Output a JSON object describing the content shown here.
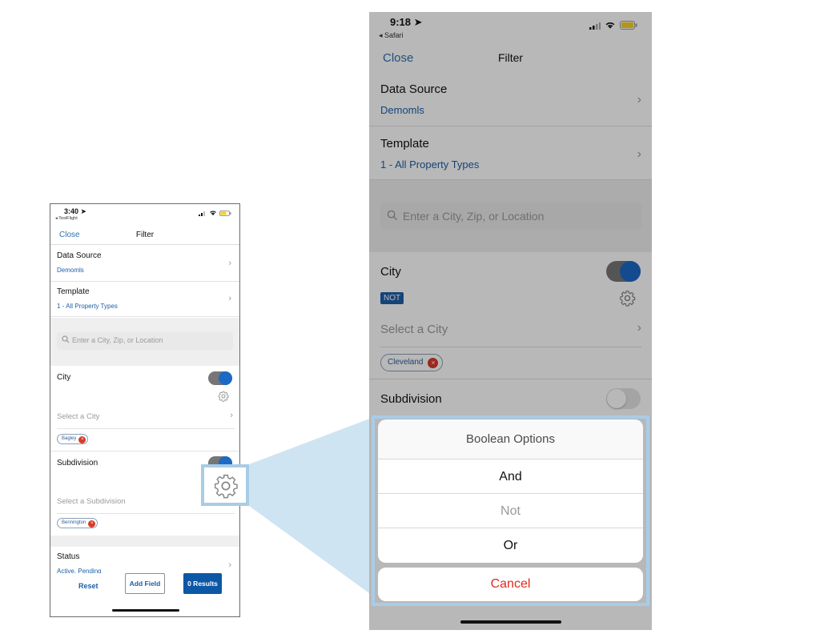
{
  "small_phone": {
    "status": {
      "time": "3:40",
      "back_app": "TestFlight"
    },
    "nav": {
      "close": "Close",
      "title": "Filter"
    },
    "data_source": {
      "label": "Data Source",
      "value": "Demomls"
    },
    "template": {
      "label": "Template",
      "value": "1 - All Property Types"
    },
    "search": {
      "placeholder": "Enter a City, Zip, or Location"
    },
    "city": {
      "label": "City",
      "select_label": "Select a City",
      "chip": "Bagley",
      "toggle_on": true
    },
    "subdivision": {
      "label": "Subdivision",
      "select_label": "Select a Subdivision",
      "chip": "Bennington",
      "toggle_on": true
    },
    "status_field": {
      "label": "Status",
      "value": "Active, Pending"
    },
    "bottom": {
      "reset": "Reset",
      "add_field": "Add Field",
      "results": "0 Results"
    }
  },
  "large_phone": {
    "status": {
      "time": "9:18",
      "back_app": "Safari"
    },
    "nav": {
      "close": "Close",
      "title": "Filter"
    },
    "data_source": {
      "label": "Data Source",
      "value": "Demomls"
    },
    "template": {
      "label": "Template",
      "value": "1 - All Property Types"
    },
    "search": {
      "placeholder": "Enter a City, Zip, or Location"
    },
    "city": {
      "label": "City",
      "badge": "NOT",
      "select_label": "Select a City",
      "chip": "Cleveland",
      "toggle_on": true
    },
    "subdivision": {
      "label": "Subdivision",
      "toggle_on": false
    },
    "action_sheet": {
      "title": "Boolean Options",
      "options": [
        {
          "label": "And",
          "enabled": true
        },
        {
          "label": "Not",
          "enabled": false
        },
        {
          "label": "Or",
          "enabled": true
        }
      ],
      "cancel": "Cancel"
    }
  },
  "colors": {
    "accent_blue": "#1d5fa8",
    "toggle_blue": "#1d69c6",
    "callout_blue": "#a9cce6",
    "cancel_red": "#e0291c",
    "chip_remove_red": "#d53a2b"
  },
  "icons": [
    "location-arrow-icon",
    "signal-icon",
    "wifi-icon",
    "battery-icon",
    "chevron-right-icon",
    "search-icon",
    "gear-icon",
    "remove-icon"
  ]
}
